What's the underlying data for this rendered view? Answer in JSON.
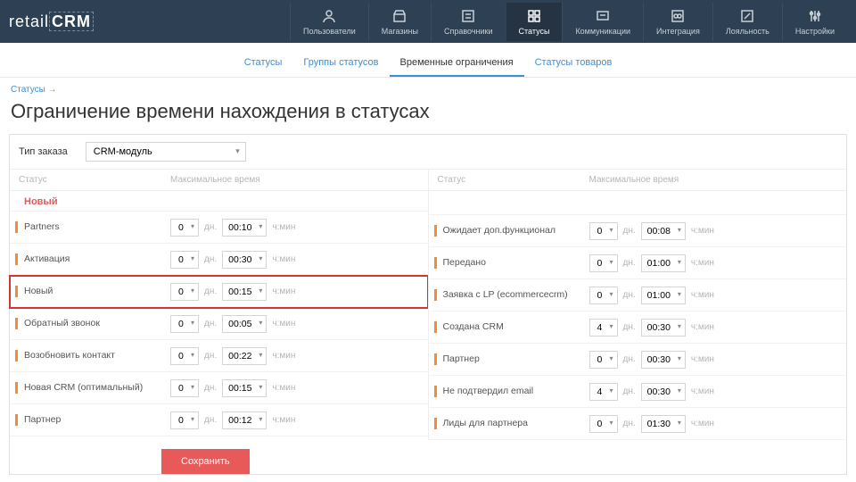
{
  "logo": {
    "prefix": "retail",
    "suffix": "CRM"
  },
  "nav": [
    {
      "label": "Пользователи",
      "icon": "user"
    },
    {
      "label": "Магазины",
      "icon": "store"
    },
    {
      "label": "Справочники",
      "icon": "list"
    },
    {
      "label": "Статусы",
      "icon": "grid",
      "active": true
    },
    {
      "label": "Коммуникации",
      "icon": "chat"
    },
    {
      "label": "Интеграция",
      "icon": "link"
    },
    {
      "label": "Лояльность",
      "icon": "percent"
    },
    {
      "label": "Настройки",
      "icon": "sliders"
    }
  ],
  "subnav": [
    {
      "label": "Статусы"
    },
    {
      "label": "Группы статусов"
    },
    {
      "label": "Временные ограничения",
      "active": true
    },
    {
      "label": "Статусы товаров"
    }
  ],
  "breadcrumb": {
    "link": "Статусы",
    "sep": "→"
  },
  "title": "Ограничение времени нахождения в статусах",
  "orderType": {
    "label": "Тип заказа",
    "value": "CRM-модуль"
  },
  "headers": {
    "status": "Статус",
    "max": "Максимальное время"
  },
  "units": {
    "days": "дн.",
    "hmin": "ч:мин"
  },
  "group": "Новый",
  "left": [
    {
      "status": "Partners",
      "d": "0",
      "t": "00:10"
    },
    {
      "status": "Активация",
      "d": "0",
      "t": "00:30"
    },
    {
      "status": "Новый",
      "d": "0",
      "t": "00:15",
      "hl": true
    },
    {
      "status": "Обратный звонок",
      "d": "0",
      "t": "00:05"
    },
    {
      "status": "Возобновить контакт",
      "d": "0",
      "t": "00:22"
    },
    {
      "status": "Новая CRM (оптимальный)",
      "d": "0",
      "t": "00:15"
    },
    {
      "status": "Партнер",
      "d": "0",
      "t": "00:12"
    }
  ],
  "right": [
    {
      "status": "Ожидает доп.функционал",
      "d": "0",
      "t": "00:08"
    },
    {
      "status": "Передано",
      "d": "0",
      "t": "01:00"
    },
    {
      "status": "Заявка с LP (ecommercecrm)",
      "d": "0",
      "t": "01:00"
    },
    {
      "status": "Создана CRM",
      "d": "4",
      "t": "00:30"
    },
    {
      "status": "Партнер",
      "d": "0",
      "t": "00:30"
    },
    {
      "status": "Не подтвердил email",
      "d": "4",
      "t": "00:30"
    },
    {
      "status": "Лиды для партнера",
      "d": "0",
      "t": "01:30"
    }
  ],
  "save": "Сохранить"
}
